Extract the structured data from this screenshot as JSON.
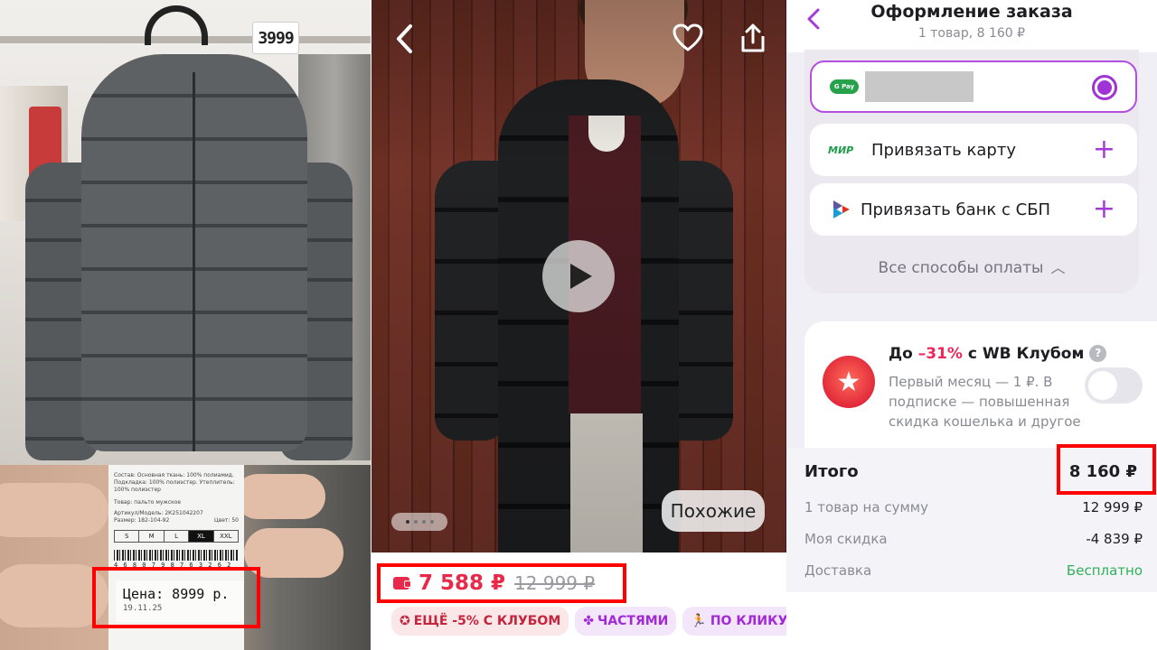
{
  "store_photo": {
    "price_tag": "3999"
  },
  "garment_label": {
    "composition": "Состав: Основная ткань: 100% полиамид. Подкладка: 100% полиэстер. Утеплитель: 100% полиэстер",
    "product": "Товар: пальто мужское",
    "article": "Артикул/Модель: 2К251042207",
    "size_row": "Размер: 182-104-92",
    "color": "Цвет: 50",
    "sizes": [
      "S",
      "M",
      "L",
      "XL",
      "XXL"
    ],
    "selected_size": "XL",
    "barcode": "4 6 8 0 7 9 8 7 6 3 2 6 2",
    "price": "Цена: 8999  р.",
    "date": "19.11.25"
  },
  "product_card": {
    "similar_label": "Похожие",
    "price_current": "7 588 ₽",
    "price_old": "12 999 ₽",
    "chips": [
      {
        "label": "ЕЩЁ -5% С КЛУБОМ",
        "glyph": "✪"
      },
      {
        "label": "ЧАСТЯМИ",
        "glyph": "✤"
      },
      {
        "label": "ПО КЛИКУ",
        "glyph": "🏃"
      }
    ],
    "gallery_dots": 4
  },
  "checkout": {
    "title": "Оформление заказа",
    "subtitle": "1 товар, 8 160 ₽",
    "gpay_label": "G Pay",
    "mir_label": "МИР",
    "link_card_label": "Привязать карту",
    "link_sbp_label": "Привязать банк с СБП",
    "all_methods_label": "Все способы оплаты",
    "club": {
      "title_prefix": "До ",
      "percent": "–31%",
      "title_suffix": " с WB Клубом",
      "description": "Первый месяц — 1 ₽. В подписке — повышенная скидка кошелька и другое",
      "help_glyph": "?"
    },
    "summary": {
      "total_label": "Итого",
      "total_value": "8 160 ₽",
      "items_label": "1 товар на сумму",
      "items_value": "12 999 ₽",
      "discount_label": "Моя скидка",
      "discount_value": "-4 839 ₽",
      "delivery_label": "Доставка",
      "delivery_value": "Бесплатно"
    }
  },
  "colors": {
    "highlight": "#ff0000",
    "accent_purple": "#a033d6",
    "price_red": "#e8294a",
    "free_green": "#2fb15a"
  }
}
